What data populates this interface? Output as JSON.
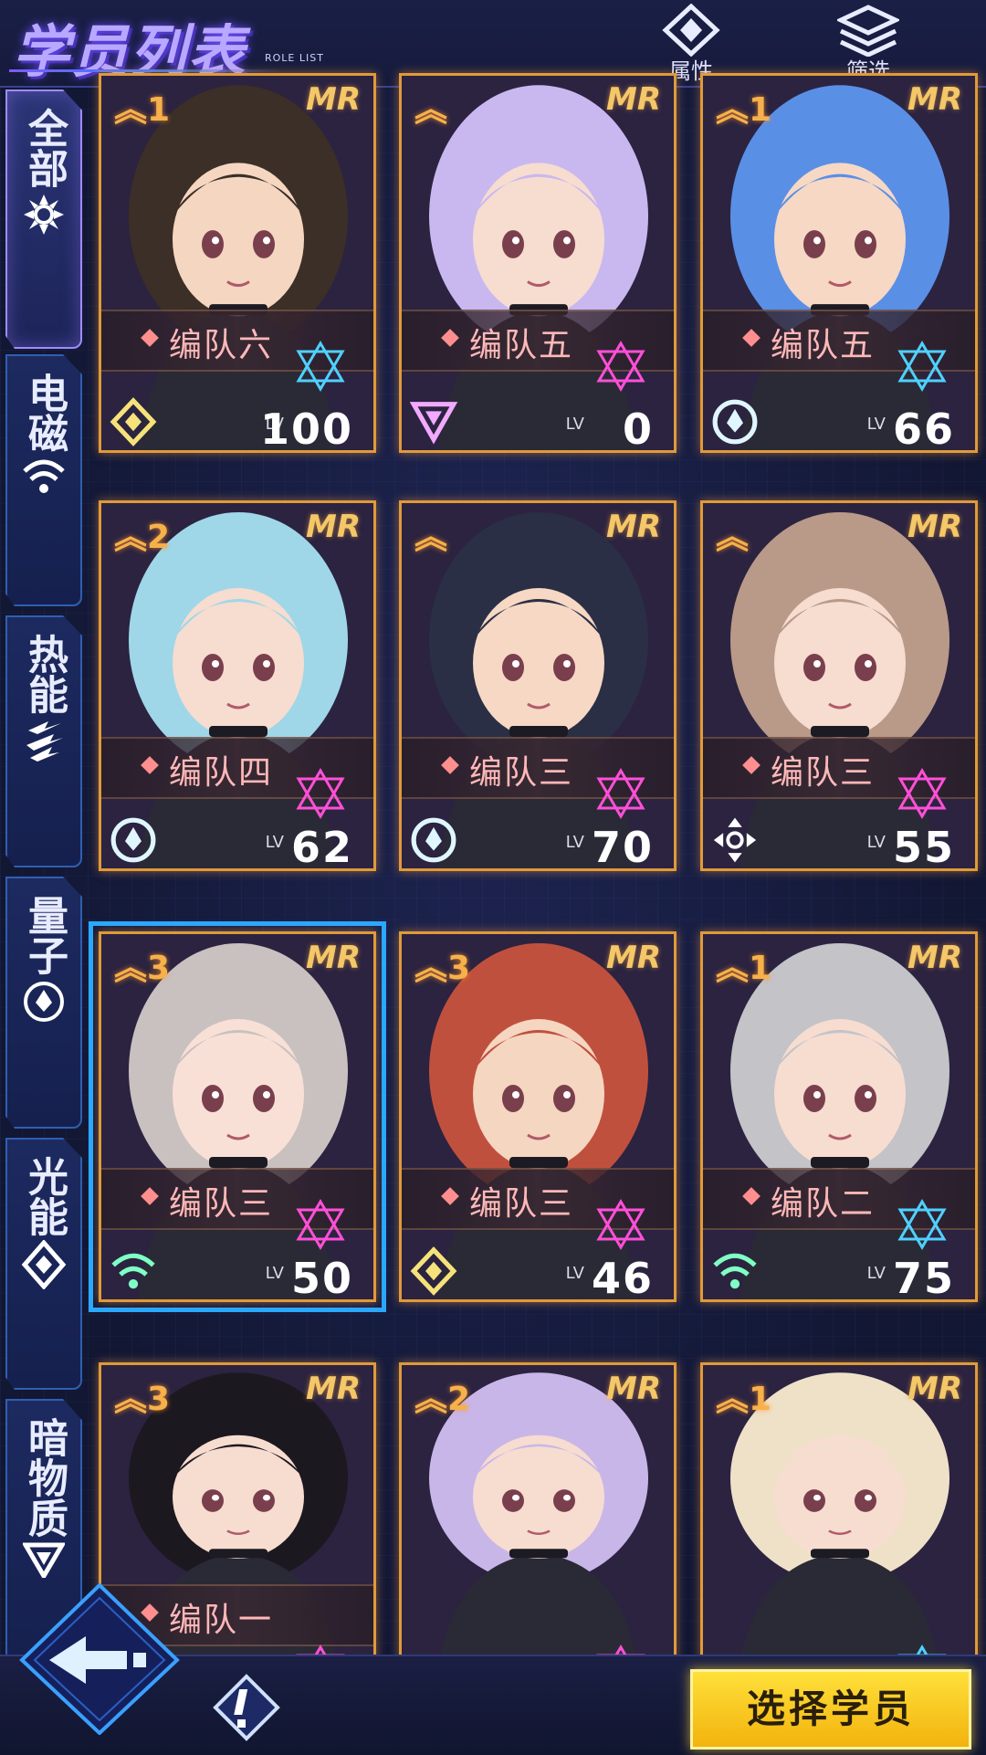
{
  "header": {
    "title": "学员列表",
    "subtitle": "ROLE LIST",
    "attr_label": "属性",
    "filter_label": "筛选"
  },
  "sidebar": {
    "tabs": [
      {
        "label": "全部",
        "icon": "all-element-icon",
        "active": true
      },
      {
        "label": "电磁",
        "icon": "wifi-icon"
      },
      {
        "label": "热能",
        "icon": "slash-icon"
      },
      {
        "label": "量子",
        "icon": "quantum-icon"
      },
      {
        "label": "光能",
        "icon": "diamond-icon"
      },
      {
        "label": "暗物质",
        "icon": "triangle-icon"
      }
    ]
  },
  "cards": [
    {
      "stars": "1",
      "rarity": "MR",
      "team": "编队六",
      "level": "100",
      "lv_tag": "LV",
      "element": "diamond",
      "hair": "#3b2f27",
      "skin": "#f5d6c0",
      "hex": "#4fd1ff"
    },
    {
      "stars": "",
      "rarity": "MR",
      "team": "编队五",
      "level": "0",
      "lv_tag": "LV",
      "element": "triangle",
      "hair": "#c9b8ef",
      "skin": "#f7dcd0",
      "hex": "#ff4fd8"
    },
    {
      "stars": "1",
      "rarity": "MR",
      "team": "编队五",
      "level": "66",
      "lv_tag": "LV",
      "element": "quantum",
      "hair": "#5a8fe6",
      "skin": "#f6d8c4",
      "hex": "#4fd1ff"
    },
    {
      "stars": "2",
      "rarity": "MR",
      "team": "编队四",
      "level": "62",
      "lv_tag": "LV",
      "element": "quantum",
      "hair": "#9fd7e8",
      "skin": "#f7dcd0",
      "hex": "#ff4fd8"
    },
    {
      "stars": "",
      "rarity": "MR",
      "team": "编队三",
      "level": "70",
      "lv_tag": "LV",
      "element": "quantum",
      "hair": "#2a2f45",
      "skin": "#f6d8c4",
      "hex": "#ff4fd8"
    },
    {
      "stars": "",
      "rarity": "MR",
      "team": "编队三",
      "level": "55",
      "lv_tag": "LV",
      "element": "cross",
      "hair": "#b99a88",
      "skin": "#f7dcd0",
      "hex": "#ff4fd8"
    },
    {
      "stars": "3",
      "rarity": "MR",
      "team": "编队三",
      "level": "50",
      "lv_tag": "LV",
      "element": "wifi",
      "hair": "#c9c1c0",
      "skin": "#f9e0d6",
      "hex": "#ff4fd8",
      "selected": true
    },
    {
      "stars": "3",
      "rarity": "MR",
      "team": "编队三",
      "level": "46",
      "lv_tag": "LV",
      "element": "diamond",
      "hair": "#c0503e",
      "skin": "#f5d6c0",
      "hex": "#ff4fd8"
    },
    {
      "stars": "1",
      "rarity": "MR",
      "team": "编队二",
      "level": "75",
      "lv_tag": "LV",
      "element": "wifi",
      "hair": "#c3c3c8",
      "skin": "#f7dcd0",
      "hex": "#4fd1ff"
    },
    {
      "stars": "3",
      "rarity": "MR",
      "team": "编队一",
      "level": "",
      "lv_tag": "",
      "element": "",
      "hair": "#1c1820",
      "skin": "#f7dcd0",
      "hex": "#ff4fd8"
    },
    {
      "stars": "2",
      "rarity": "MR",
      "team": "",
      "level": "",
      "lv_tag": "",
      "element": "",
      "hair": "#c9b6e8",
      "skin": "#f7dcd0",
      "hex": "#ff4fd8"
    },
    {
      "stars": "1",
      "rarity": "MR",
      "team": "",
      "level": "",
      "lv_tag": "",
      "element": "",
      "hair": "#efe1c8",
      "skin": "#f7dcd0",
      "hex": "#4fd1ff"
    }
  ],
  "bottom": {
    "select_label": "选择学员"
  },
  "colors": {
    "card_border": "#e09a3a",
    "select_button": "#f8cf22",
    "selected_outline": "#2aa8ff"
  }
}
